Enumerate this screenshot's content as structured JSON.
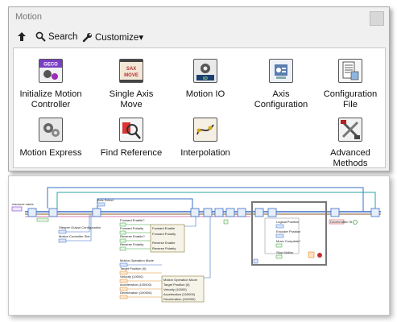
{
  "palette": {
    "title": "Motion",
    "toolbar": {
      "search_label": "Search",
      "customize_label": "Customize▾"
    },
    "items": [
      {
        "label": "Initialize Motion\nController",
        "icon": "geco-init-icon",
        "icon_text": "GECO"
      },
      {
        "label": "Single Axis\nMove",
        "icon": "single-axis-move-icon",
        "icon_text": "SAX\nMOVE"
      },
      {
        "label": "Motion IO",
        "icon": "motion-io-icon",
        "icon_text": "IO"
      },
      {
        "label": "Axis\nConfiguration",
        "icon": "axis-configuration-icon",
        "icon_text": ""
      },
      {
        "label": "Configuration\nFile",
        "icon": "configuration-file-icon",
        "icon_text": ""
      },
      {
        "label": "Motion Express",
        "icon": "motion-express-icon",
        "icon_text": ""
      },
      {
        "label": "Find Reference",
        "icon": "find-reference-icon",
        "icon_text": ""
      },
      {
        "label": "Interpolation",
        "icon": "interpolation-icon",
        "icon_text": ""
      },
      {
        "label": "Advanced\nMethods",
        "icon": "advanced-methods-icon",
        "icon_text": ""
      }
    ]
  },
  "diagram": {
    "labels": {
      "resource_name": "resource name",
      "axis_select": "Axis Select",
      "stepper_output": "Stepper Output Configuration",
      "motion_controller_slot": "Motion Controller Slot",
      "forward_enable_q": "Forward Enable?",
      "forward_polarity": "Forward Polarity",
      "reverse_enable_q": "Reverse Enable?",
      "reverse_polarity": "Reverse Polarity",
      "forward_enable": "Forward Enable",
      "forward_polarity_node": "Forward Polarity",
      "reverse_enable": "Reverse Enable",
      "reverse_polarity_node": "Reverse Polarity",
      "motion_operation_mode": "Motion Operation Mode",
      "target_position_0": "Target Position (0)",
      "velocity": "Velocity (10000)",
      "acceleration": "Acceleration (100000)",
      "deceleration": "Deceleration (100000)",
      "motion_operation_mode_node": "Motion Operation Mode",
      "target_position_node": "Target Position (0)",
      "velocity_node": "Velocity (10000)",
      "acceleration_node": "Acceleration (100000)",
      "deceleration_node": "Deceleration (100000)",
      "logical_position": "Logical Position",
      "encoder_position": "Encoder Position",
      "move_complete": "Move Complete?",
      "stop_motion": "Stop Motion",
      "deceleration_stop": "Deceleration St",
      "stop_text": "Stop",
      "flag_101": "101"
    },
    "colors": {
      "wire_blue": "#3b6fc8",
      "wire_teal": "#2aa3a3",
      "wire_orange": "#e08c2a",
      "wire_green": "#3da33d",
      "wire_pink": "#cc5599",
      "wire_brown": "#8a5a2a"
    }
  }
}
